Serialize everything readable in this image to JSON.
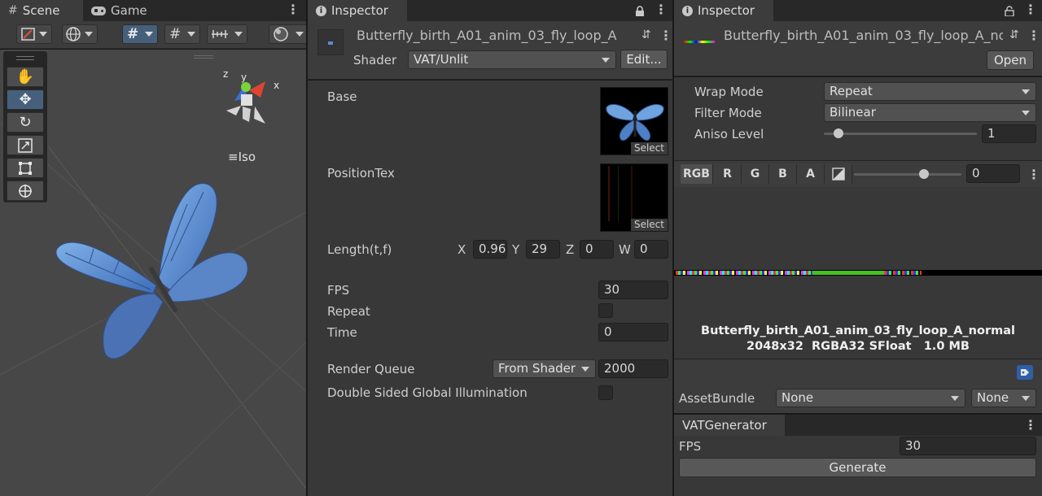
{
  "scene_panel": {
    "tabs": [
      {
        "label": "Scene",
        "icon": "grid-icon"
      },
      {
        "label": "Game",
        "icon": "gamepad-icon"
      }
    ],
    "iso_label": "Iso",
    "gizmo_axes": {
      "x": "x",
      "y": "y",
      "z": "z"
    },
    "tools": [
      "hand-tool",
      "move-tool",
      "rotate-tool",
      "scale-tool",
      "rect-tool",
      "transform-tool"
    ],
    "active_tool": "move-tool"
  },
  "material_inspector": {
    "tab_label": "Inspector",
    "asset_name": "Butterfly_birth_A01_anim_03_fly_loop_A",
    "shader_label": "Shader",
    "shader_value": "VAT/Unlit",
    "edit_label": "Edit...",
    "base_label": "Base",
    "position_tex_label": "PositionTex",
    "select_label": "Select",
    "length_label": "Length(t,f)",
    "length": {
      "x_label": "X",
      "x": "0.96",
      "y_label": "Y",
      "y": "29",
      "z_label": "Z",
      "z": "0",
      "w_label": "W",
      "w": "0"
    },
    "fps_label": "FPS",
    "fps_value": "30",
    "repeat_label": "Repeat",
    "time_label": "Time",
    "time_value": "0",
    "render_queue_label": "Render Queue",
    "render_queue_mode": "From Shader",
    "render_queue_value": "2000",
    "dsgi_label": "Double Sided Global Illumination"
  },
  "texture_inspector": {
    "tab_label": "Inspector",
    "asset_name": "Butterfly_birth_A01_anim_03_fly_loop_A_normal",
    "open_label": "Open",
    "wrap_mode_label": "Wrap Mode",
    "wrap_mode_value": "Repeat",
    "filter_mode_label": "Filter Mode",
    "filter_mode_value": "Bilinear",
    "aniso_label": "Aniso Level",
    "aniso_value": "1",
    "aniso_level": 1,
    "channels": [
      "RGB",
      "R",
      "G",
      "B",
      "A"
    ],
    "active_channel": "RGB",
    "mip_value": "0",
    "mip_level": 0.65,
    "preview_name": "Butterfly_birth_A01_anim_03_fly_loop_A_normal",
    "preview_info": "2048x32  RGBA32 SFloat   1.0 MB",
    "assetbundle_label": "AssetBundle",
    "assetbundle_value": "None",
    "assetbundle_variant": "None"
  },
  "vat_generator": {
    "title": "VATGenerator",
    "fps_label": "FPS",
    "fps_value": "30",
    "generate_label": "Generate"
  },
  "colors": {
    "accent": "#46607c",
    "panel": "#383838",
    "field": "#2a2a2a",
    "tag_blue": "#2f5fa8"
  }
}
